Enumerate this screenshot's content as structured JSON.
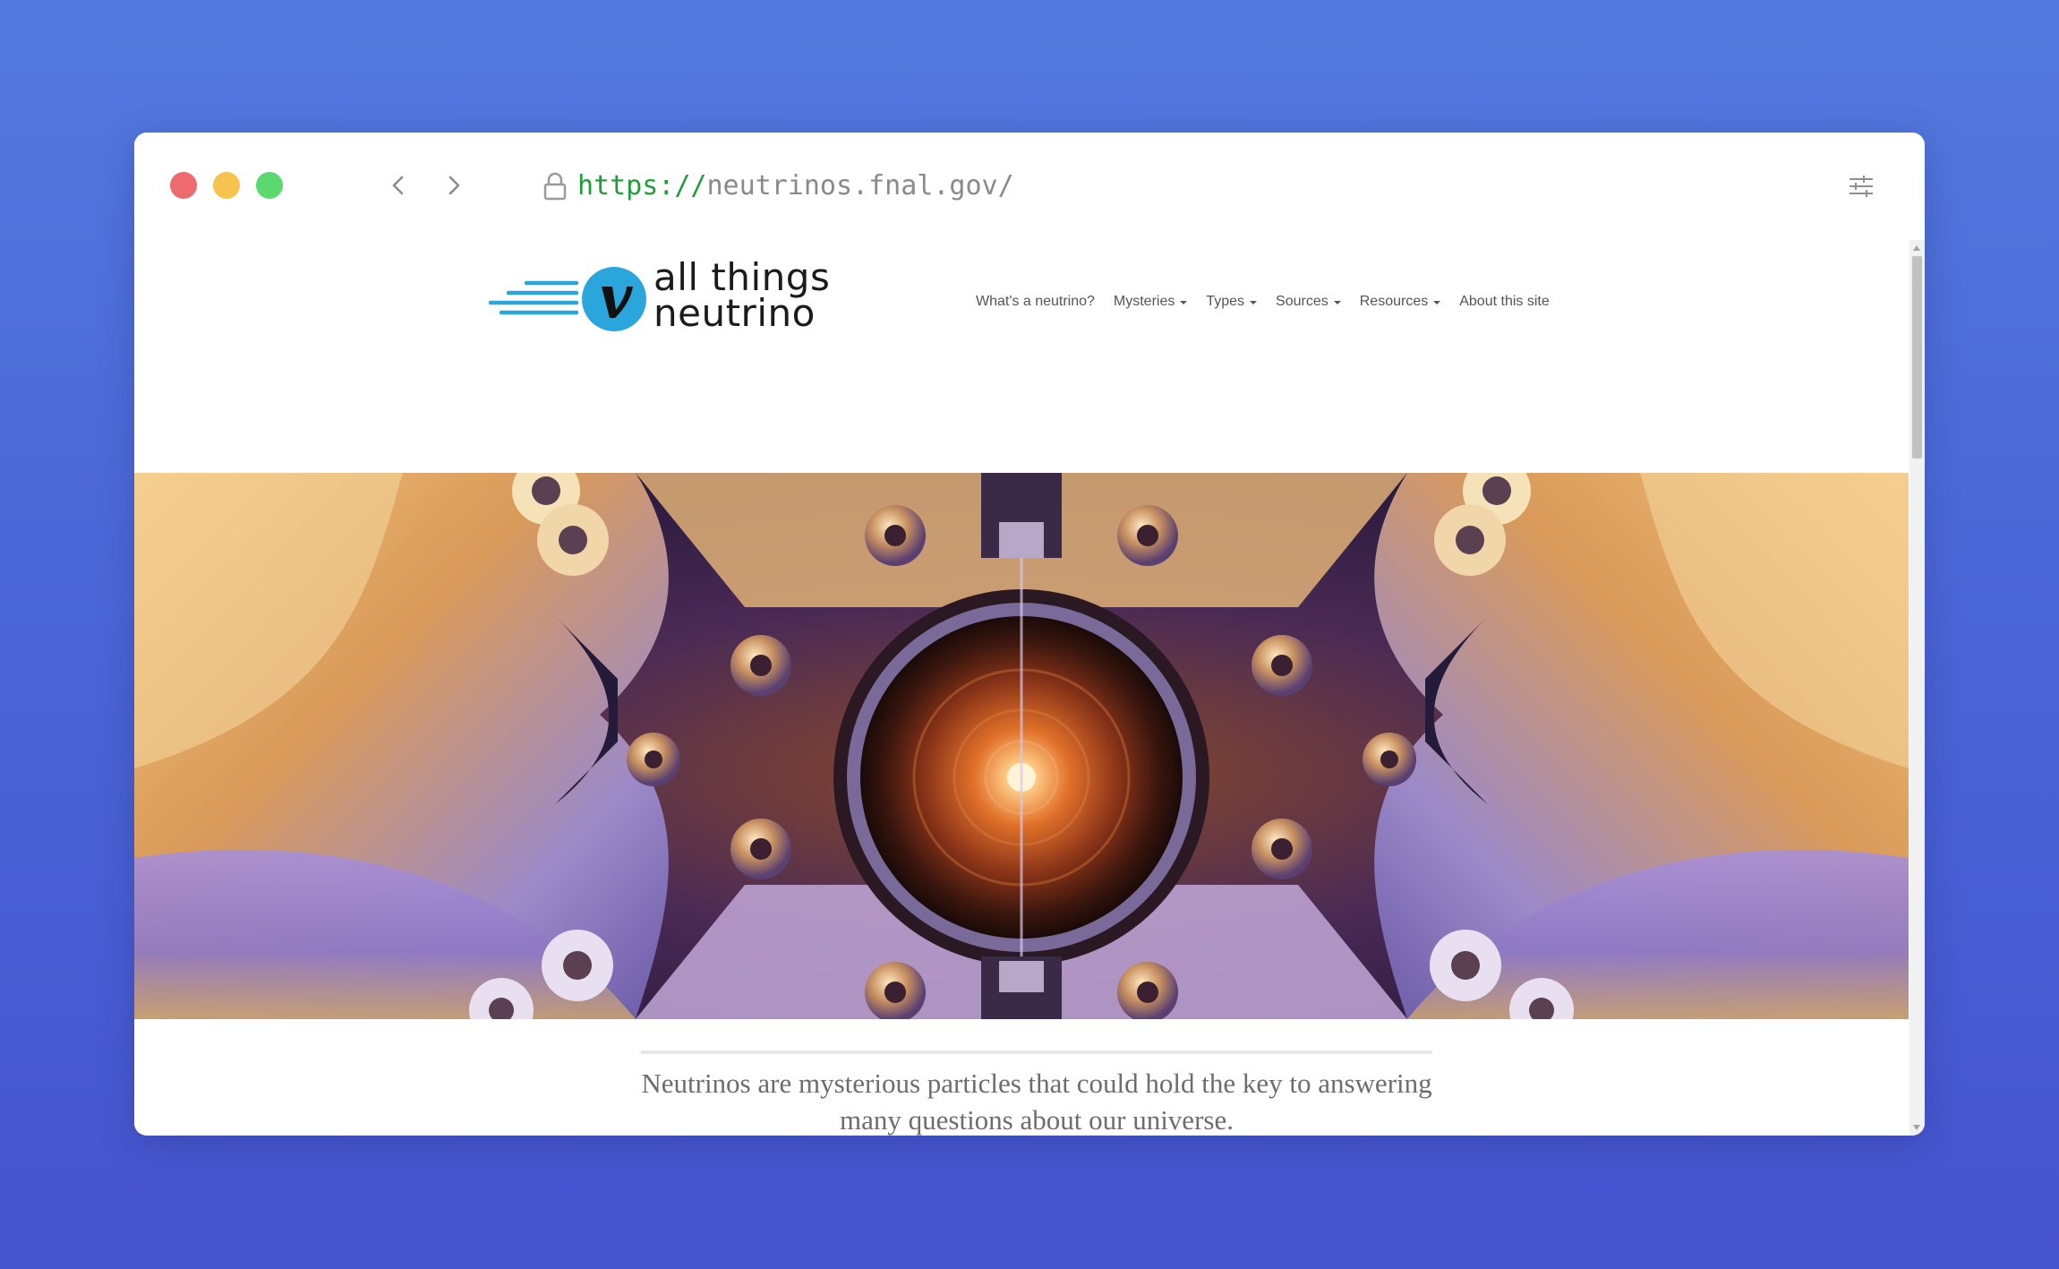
{
  "browser": {
    "url_scheme": "https://",
    "url_host": "neutrinos.fnal.gov/",
    "icons": {
      "close": "window-close-icon",
      "minimize": "window-minimize-icon",
      "maximize": "window-maximize-icon",
      "back": "chevron-left-icon",
      "forward": "chevron-right-icon",
      "lock": "lock-icon",
      "settings": "sliders-icon"
    },
    "colors": {
      "close": "#ee6b6d",
      "minimize": "#f6c34e",
      "maximize": "#5bd96f",
      "url_scheme": "#1f9d3a",
      "url_host": "#8a8a8a",
      "background": "#4f6ada"
    }
  },
  "site": {
    "logo": {
      "line1": "all things",
      "line2": "neutrino",
      "symbol": "ν",
      "color": "#2aa6dc"
    },
    "nav": [
      {
        "label": "What's a neutrino?",
        "dropdown": false
      },
      {
        "label": "Mysteries",
        "dropdown": true
      },
      {
        "label": "Types",
        "dropdown": true
      },
      {
        "label": "Sources",
        "dropdown": true
      },
      {
        "label": "Resources",
        "dropdown": true
      },
      {
        "label": "About this site",
        "dropdown": false
      }
    ],
    "intro_text": "Neutrinos are mysterious particles that could hold the key to answering many questions about our universe.",
    "accent_color": "#f39035"
  }
}
